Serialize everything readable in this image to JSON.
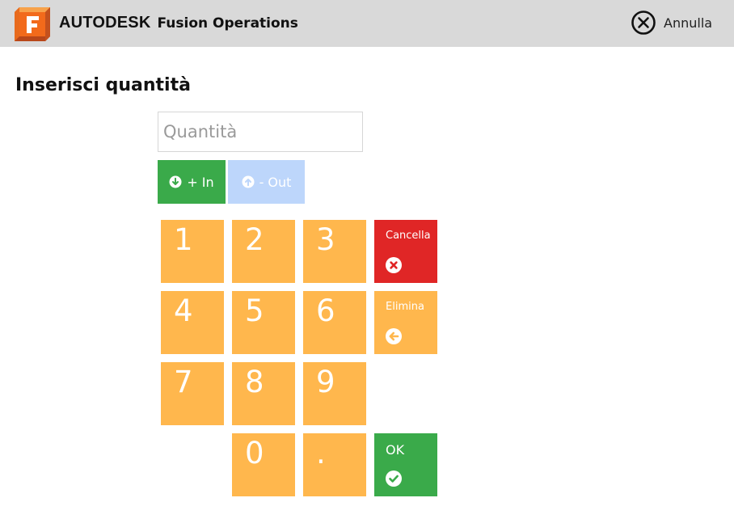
{
  "header": {
    "brand_strong": "AUTODESK",
    "brand_product": "Fusion Operations",
    "logo_letter": "F",
    "cancel_label": "Annulla",
    "cancel_icon": "close-circle-icon",
    "background": "#d9d9d9"
  },
  "page": {
    "title": "Inserisci quantità"
  },
  "quantity_input": {
    "placeholder": "Quantità",
    "value": ""
  },
  "direction": {
    "in_label": "+ In",
    "in_icon": "arrow-down-circle-icon",
    "in_color": "#3aaa4a",
    "out_label": "- Out",
    "out_icon": "arrow-up-circle-icon",
    "out_color": "#bdd6fb"
  },
  "keypad": {
    "keys": [
      "1",
      "2",
      "3",
      "4",
      "5",
      "6",
      "7",
      "8",
      "9",
      "0",
      "."
    ],
    "key_color": "#ffb74d",
    "cancella_label": "Cancella",
    "cancella_icon": "x-circle-icon",
    "cancella_color": "#e02626",
    "elimina_label": "Elimina",
    "elimina_icon": "arrow-left-circle-icon",
    "ok_label": "OK",
    "ok_icon": "check-circle-icon",
    "ok_color": "#3aaa4a"
  }
}
